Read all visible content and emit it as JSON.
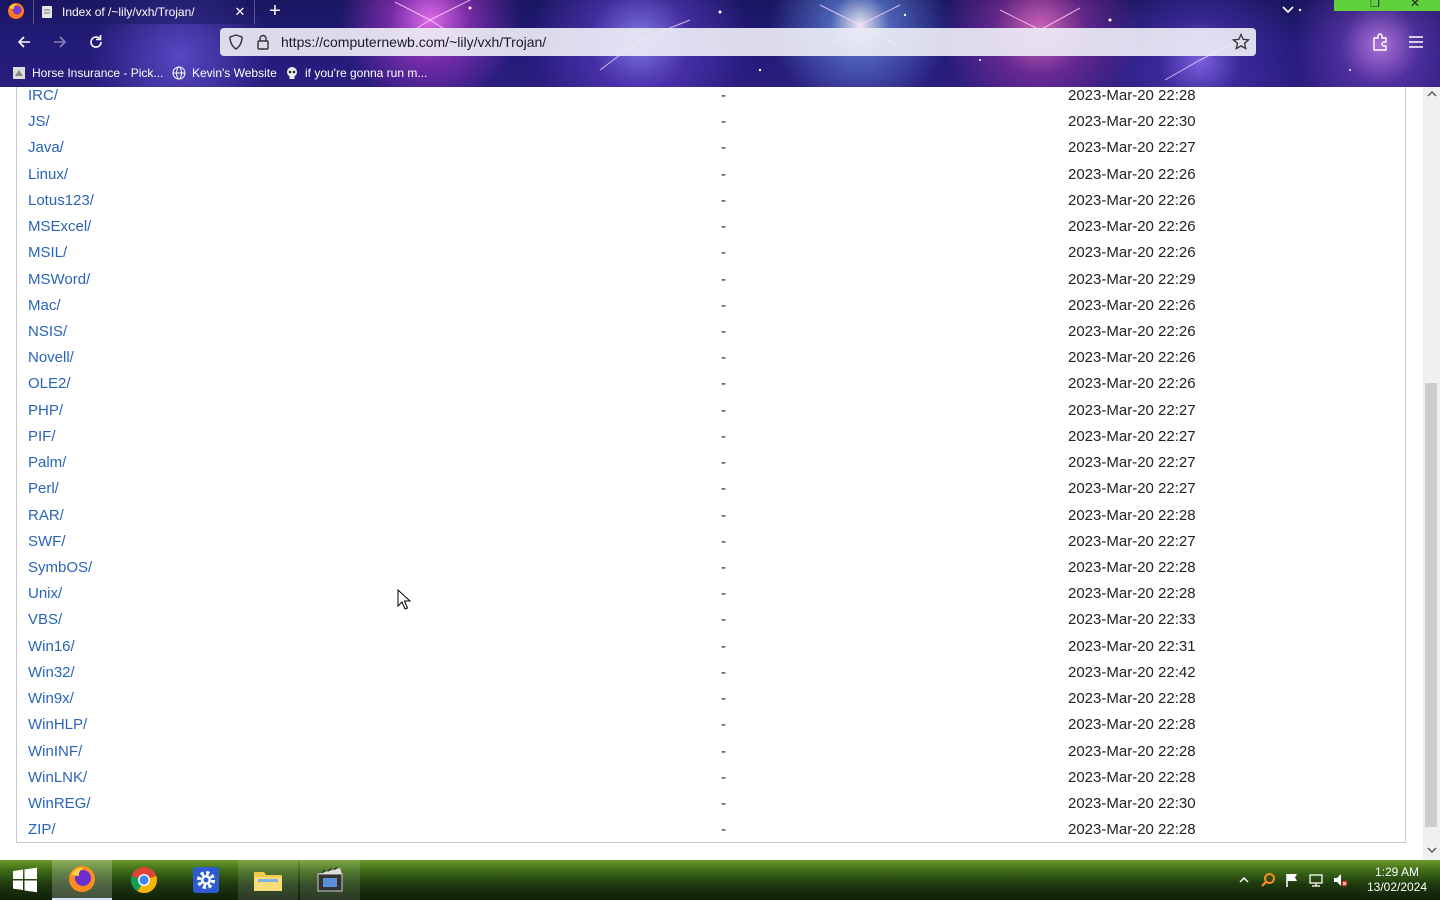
{
  "browser": {
    "tab_title": "Index of /~lily/vxh/Trojan/",
    "new_tab_symbol": "+",
    "url": "https://computernewb.com/~lily/vxh/Trojan/",
    "bookmarks": [
      {
        "label": "Horse Insurance - Pick...",
        "icon": "page-icon"
      },
      {
        "label": "Kevin's Website",
        "icon": "globe-icon"
      },
      {
        "label": "if you're gonna run m...",
        "icon": "skull-icon"
      }
    ]
  },
  "listing": {
    "rows": [
      {
        "name": "IRC/",
        "size": "-",
        "date": "2023-Mar-20 22:28"
      },
      {
        "name": "JS/",
        "size": "-",
        "date": "2023-Mar-20 22:30"
      },
      {
        "name": "Java/",
        "size": "-",
        "date": "2023-Mar-20 22:27"
      },
      {
        "name": "Linux/",
        "size": "-",
        "date": "2023-Mar-20 22:26"
      },
      {
        "name": "Lotus123/",
        "size": "-",
        "date": "2023-Mar-20 22:26"
      },
      {
        "name": "MSExcel/",
        "size": "-",
        "date": "2023-Mar-20 22:26"
      },
      {
        "name": "MSIL/",
        "size": "-",
        "date": "2023-Mar-20 22:26"
      },
      {
        "name": "MSWord/",
        "size": "-",
        "date": "2023-Mar-20 22:29"
      },
      {
        "name": "Mac/",
        "size": "-",
        "date": "2023-Mar-20 22:26"
      },
      {
        "name": "NSIS/",
        "size": "-",
        "date": "2023-Mar-20 22:26"
      },
      {
        "name": "Novell/",
        "size": "-",
        "date": "2023-Mar-20 22:26"
      },
      {
        "name": "OLE2/",
        "size": "-",
        "date": "2023-Mar-20 22:26"
      },
      {
        "name": "PHP/",
        "size": "-",
        "date": "2023-Mar-20 22:27"
      },
      {
        "name": "PIF/",
        "size": "-",
        "date": "2023-Mar-20 22:27"
      },
      {
        "name": "Palm/",
        "size": "-",
        "date": "2023-Mar-20 22:27"
      },
      {
        "name": "Perl/",
        "size": "-",
        "date": "2023-Mar-20 22:27"
      },
      {
        "name": "RAR/",
        "size": "-",
        "date": "2023-Mar-20 22:28"
      },
      {
        "name": "SWF/",
        "size": "-",
        "date": "2023-Mar-20 22:27"
      },
      {
        "name": "SymbOS/",
        "size": "-",
        "date": "2023-Mar-20 22:28"
      },
      {
        "name": "Unix/",
        "size": "-",
        "date": "2023-Mar-20 22:28"
      },
      {
        "name": "VBS/",
        "size": "-",
        "date": "2023-Mar-20 22:33"
      },
      {
        "name": "Win16/",
        "size": "-",
        "date": "2023-Mar-20 22:31"
      },
      {
        "name": "Win32/",
        "size": "-",
        "date": "2023-Mar-20 22:42"
      },
      {
        "name": "Win9x/",
        "size": "-",
        "date": "2023-Mar-20 22:28"
      },
      {
        "name": "WinHLP/",
        "size": "-",
        "date": "2023-Mar-20 22:28"
      },
      {
        "name": "WinINF/",
        "size": "-",
        "date": "2023-Mar-20 22:28"
      },
      {
        "name": "WinLNK/",
        "size": "-",
        "date": "2023-Mar-20 22:28"
      },
      {
        "name": "WinREG/",
        "size": "-",
        "date": "2023-Mar-20 22:30"
      },
      {
        "name": "ZIP/",
        "size": "-",
        "date": "2023-Mar-20 22:28"
      }
    ]
  },
  "taskbar": {
    "apps": [
      {
        "name": "firefox-taskbar-button",
        "icon": "firefox-icon",
        "active": true
      },
      {
        "name": "chrome-taskbar-button",
        "icon": "chrome-icon",
        "active": false
      },
      {
        "name": "settings-taskbar-button",
        "icon": "gear-icon",
        "active": false
      },
      {
        "name": "file-explorer-taskbar-button",
        "icon": "folder-icon",
        "active": false
      },
      {
        "name": "movie-maker-taskbar-button",
        "icon": "film-icon",
        "active": false
      }
    ],
    "clock": {
      "time": "1:29 AM",
      "date": "13/02/2024"
    }
  },
  "colors": {
    "link": "#2a64b8",
    "taskbar_active": "rgba(255,255,255,0.22)",
    "window_control_accent": "#5fcf3a"
  }
}
